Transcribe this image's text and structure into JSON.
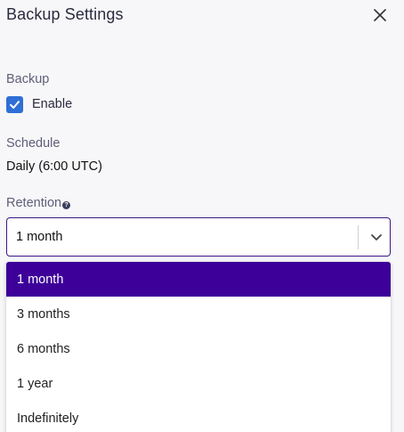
{
  "header": {
    "title": "Backup Settings",
    "close_icon": "close-icon"
  },
  "backup": {
    "label": "Backup",
    "checkbox_label": "Enable",
    "checked": true
  },
  "schedule": {
    "label": "Schedule",
    "value": "Daily (6:00 UTC)"
  },
  "retention": {
    "label": "Retention",
    "help_icon": "question-circle-icon",
    "selected": "1 month",
    "options": [
      "1 month",
      "3 months",
      "6 months",
      "1 year",
      "Indefinitely"
    ]
  },
  "colors": {
    "accent": "#3d0099",
    "focus_border": "#3b1785",
    "checkbox": "#2f6fd6",
    "background": "#f7f7f9"
  }
}
